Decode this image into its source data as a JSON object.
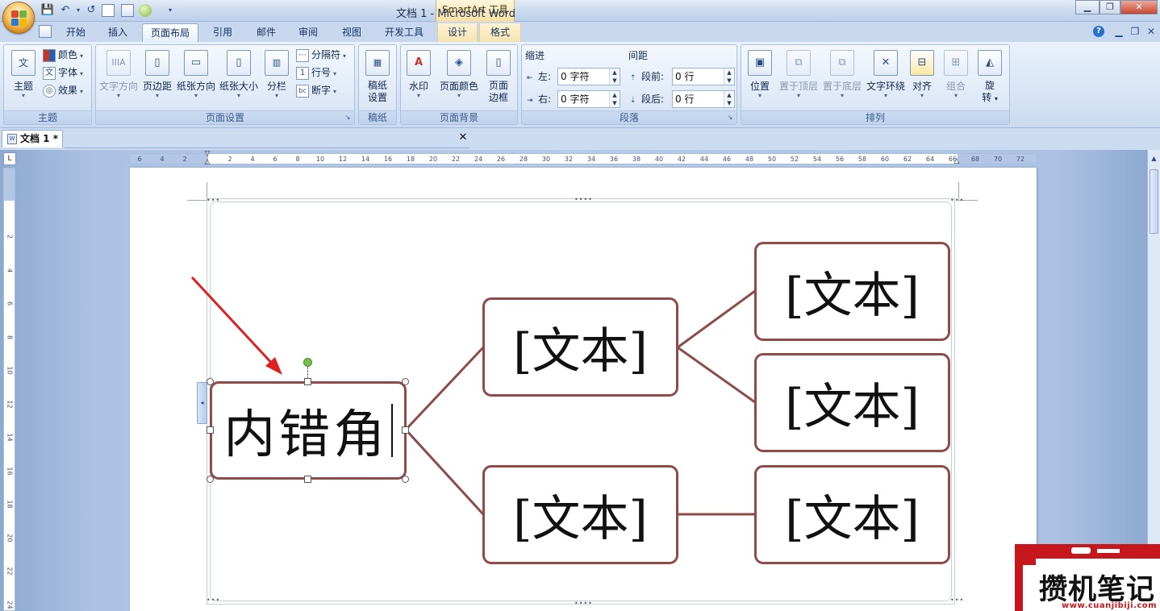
{
  "window": {
    "title": "文档 1 - Microsoft Word",
    "context_title": "SmartArt 工具",
    "minimize": "▁",
    "restore": "❐",
    "close": "✕"
  },
  "qat": {
    "save": "💾",
    "undo": "↶",
    "redo": "↺",
    "more": "▾"
  },
  "tabs": [
    {
      "label": "开始"
    },
    {
      "label": "插入"
    },
    {
      "label": "页面布局",
      "active": true
    },
    {
      "label": "引用"
    },
    {
      "label": "邮件"
    },
    {
      "label": "审阅"
    },
    {
      "label": "视图"
    },
    {
      "label": "开发工具"
    },
    {
      "label": "设计",
      "context": true
    },
    {
      "label": "格式",
      "context": true
    }
  ],
  "ribbon": {
    "themes": {
      "label": "主题",
      "theme_btn": "主题",
      "colors": "颜色",
      "fonts": "字体",
      "effects": "效果"
    },
    "page_setup": {
      "label": "页面设置",
      "text_direction": "文字方向",
      "margins": "页边距",
      "orientation": "纸张方向",
      "size": "纸张大小",
      "columns": "分栏",
      "breaks": "分隔符",
      "line_numbers": "行号",
      "hyphenation": "断字"
    },
    "manuscript": {
      "label": "稿纸",
      "button_line1": "稿纸",
      "button_line2": "设置"
    },
    "page_background": {
      "label": "页面背景",
      "watermark": "水印",
      "page_color": "页面颜色",
      "borders_line1": "页面",
      "borders_line2": "边框"
    },
    "paragraph": {
      "label": "段落",
      "indent_header": "缩进",
      "indent_left_label": "左:",
      "indent_left_value": "0 字符",
      "indent_right_label": "右:",
      "indent_right_value": "0 字符",
      "spacing_header": "间距",
      "spacing_before_label": "段前:",
      "spacing_before_value": "0 行",
      "spacing_after_label": "段后:",
      "spacing_after_value": "0 行"
    },
    "arrange": {
      "label": "排列",
      "position": "位置",
      "bring_front": "置于顶层",
      "send_back": "置于底层",
      "text_wrap": "文字环绕",
      "align": "对齐",
      "group": "组合",
      "rotate_line1": "旋",
      "rotate_line2": "转"
    }
  },
  "document_tab": {
    "title": "文档 1 *",
    "close": "✕"
  },
  "ruler": {
    "corner": "L",
    "horizontal_ticks": [
      "6",
      "4",
      "2",
      "2",
      "4",
      "6",
      "8",
      "10",
      "12",
      "14",
      "16",
      "18",
      "20",
      "22",
      "24",
      "26",
      "28",
      "30",
      "32",
      "34",
      "36",
      "38",
      "40",
      "42",
      "44",
      "46",
      "48",
      "50",
      "52",
      "54",
      "56",
      "58",
      "60",
      "62",
      "64",
      "66",
      "68",
      "70",
      "72"
    ],
    "vertical_ticks": [
      "2",
      "4",
      "6",
      "8",
      "10",
      "12",
      "14",
      "16",
      "18",
      "20",
      "22",
      "24"
    ]
  },
  "smartart": {
    "root": {
      "text": "内错角"
    },
    "level2": [
      {
        "text": "[文本]"
      },
      {
        "text": "[文本]"
      }
    ],
    "level3": [
      {
        "text": "[文本]"
      },
      {
        "text": "[文本]"
      },
      {
        "text": "[文本]"
      }
    ],
    "text_pane_toggle": "◂",
    "colors": {
      "border": "#8e4b48",
      "annotation_arrow": "#e02020"
    }
  },
  "watermark": {
    "name": "攒机笔记",
    "url": "www.cuanjibiji.com"
  }
}
